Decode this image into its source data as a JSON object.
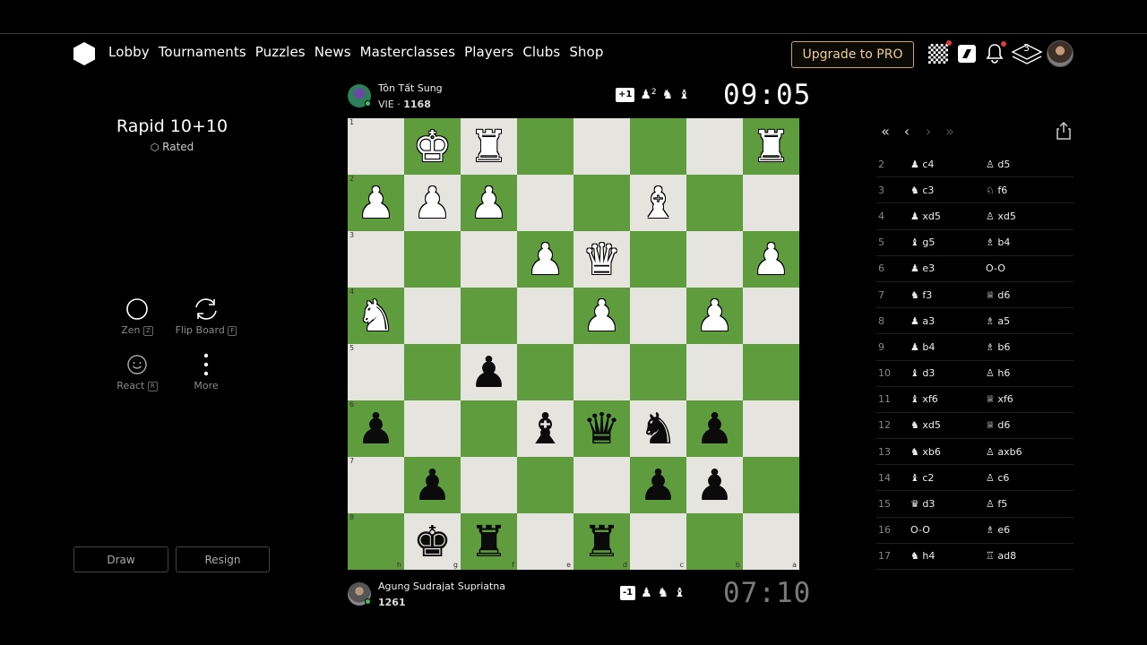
{
  "nav": {
    "items": [
      "Lobby",
      "Tournaments",
      "Puzzles",
      "News",
      "Masterclasses",
      "Players",
      "Clubs",
      "Shop"
    ],
    "upgrade_label": "Upgrade to PRO",
    "layers_count": "3"
  },
  "game": {
    "title": "Rapid 10+10",
    "rated_label": "Rated"
  },
  "tools": {
    "zen": "Zen",
    "zen_key": "Z",
    "flip": "Flip Board",
    "flip_key": "F",
    "react": "React",
    "react_key": "R",
    "more": "More"
  },
  "actions": {
    "draw": "Draw",
    "resign": "Resign"
  },
  "top_player": {
    "name": "Tôn Tất Sung",
    "country": "VIE",
    "rating": "1168",
    "material_badge": "+1",
    "material_pawn_count": "2",
    "clock": "09:05"
  },
  "bottom_player": {
    "name": "Agung Sudrajat Supriatna",
    "rating": "1261",
    "material_badge": "-1",
    "clock": "07:10"
  },
  "board": {
    "light_color": "#e6e4df",
    "dark_color": "#5f9c3e",
    "ranks": [
      "1",
      "2",
      "3",
      "4",
      "5",
      "6",
      "7",
      "8"
    ],
    "files": [
      "h",
      "g",
      "f",
      "e",
      "d",
      "c",
      "b",
      "a"
    ],
    "rows": [
      [
        "",
        "wk",
        "wr",
        "",
        "",
        "",
        "",
        "wr"
      ],
      [
        "wp",
        "wp",
        "wp",
        "",
        "",
        "wb",
        "",
        ""
      ],
      [
        "",
        "",
        "",
        "wp",
        "wq",
        "",
        "",
        "wp"
      ],
      [
        "wn",
        "",
        "",
        "",
        "wp",
        "",
        "wp",
        ""
      ],
      [
        "",
        "",
        "bp",
        "",
        "",
        "",
        "",
        ""
      ],
      [
        "bp",
        "",
        "",
        "bb",
        "bq",
        "bn",
        "bp",
        ""
      ],
      [
        "",
        "bp",
        "",
        "",
        "",
        "bp",
        "bp",
        ""
      ],
      [
        "",
        "bk",
        "br",
        "",
        "br",
        "",
        "",
        ""
      ]
    ]
  },
  "moves": [
    {
      "n": "2",
      "w": "♟ c4",
      "b": "♙ d5"
    },
    {
      "n": "3",
      "w": "♞ c3",
      "b": "♘ f6"
    },
    {
      "n": "4",
      "w": "♟ xd5",
      "b": "♙ xd5"
    },
    {
      "n": "5",
      "w": "♝ g5",
      "b": "♗ b4"
    },
    {
      "n": "6",
      "w": "♟ e3",
      "b": "O-O"
    },
    {
      "n": "7",
      "w": "♞ f3",
      "b": "♕ d6"
    },
    {
      "n": "8",
      "w": "♟ a3",
      "b": "♗ a5"
    },
    {
      "n": "9",
      "w": "♟ b4",
      "b": "♗ b6"
    },
    {
      "n": "10",
      "w": "♝ d3",
      "b": "♙ h6"
    },
    {
      "n": "11",
      "w": "♝ xf6",
      "b": "♕ xf6"
    },
    {
      "n": "12",
      "w": "♞ xd5",
      "b": "♕ d6"
    },
    {
      "n": "13",
      "w": "♞ xb6",
      "b": "♙ axb6"
    },
    {
      "n": "14",
      "w": "♝ c2",
      "b": "♙ c6"
    },
    {
      "n": "15",
      "w": "♛ d3",
      "b": "♙ f5"
    },
    {
      "n": "16",
      "w": "O-O",
      "b": "♗ e6"
    },
    {
      "n": "17",
      "w": "♞ h4",
      "b": "♖ ad8"
    }
  ]
}
